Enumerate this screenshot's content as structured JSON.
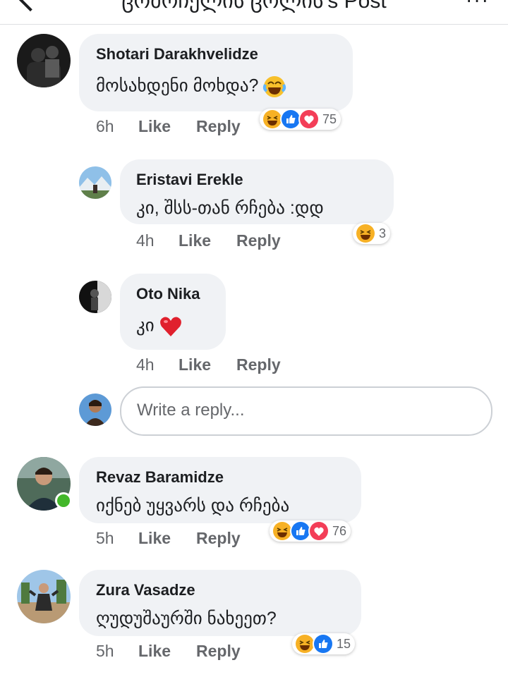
{
  "header": {
    "title": "ცომოჩელის ცოლის's Post",
    "more": "···"
  },
  "comments": [
    {
      "author": "Shotari Darakhvelidze",
      "text": "მოსახდენი მოხდა?",
      "time": "6h",
      "like": "Like",
      "reply": "Reply",
      "reaction_count": "75",
      "reactions": [
        "haha-icon",
        "like-icon",
        "love-icon"
      ]
    },
    {
      "author": "Eristavi Erekle",
      "text": "კი, შსს-თან რჩება :დდ",
      "time": "4h",
      "like": "Like",
      "reply": "Reply",
      "reaction_count": "3",
      "reactions": [
        "haha-icon"
      ]
    },
    {
      "author": "Oto Nika",
      "text": "კი",
      "time": "4h",
      "like": "Like",
      "reply": "Reply"
    },
    {
      "author": "Revaz Baramidze",
      "text": "იქნებ უყვარს და რჩება",
      "time": "5h",
      "like": "Like",
      "reply": "Reply",
      "reaction_count": "76",
      "reactions": [
        "haha-icon",
        "like-icon",
        "love-icon"
      ]
    },
    {
      "author": "Zura Vasadze",
      "text": "ღუდუშაურში ნახეეთ?",
      "time": "5h",
      "like": "Like",
      "reply": "Reply",
      "reaction_count": "15",
      "reactions": [
        "haha-icon",
        "like-icon"
      ]
    }
  ],
  "reply_box": {
    "placeholder": "Write a reply..."
  },
  "colors": {
    "like": "#1877f2",
    "love": "#f33e58",
    "haha": "#f7b125",
    "online": "#42b72a",
    "bubble": "#f0f2f5"
  }
}
